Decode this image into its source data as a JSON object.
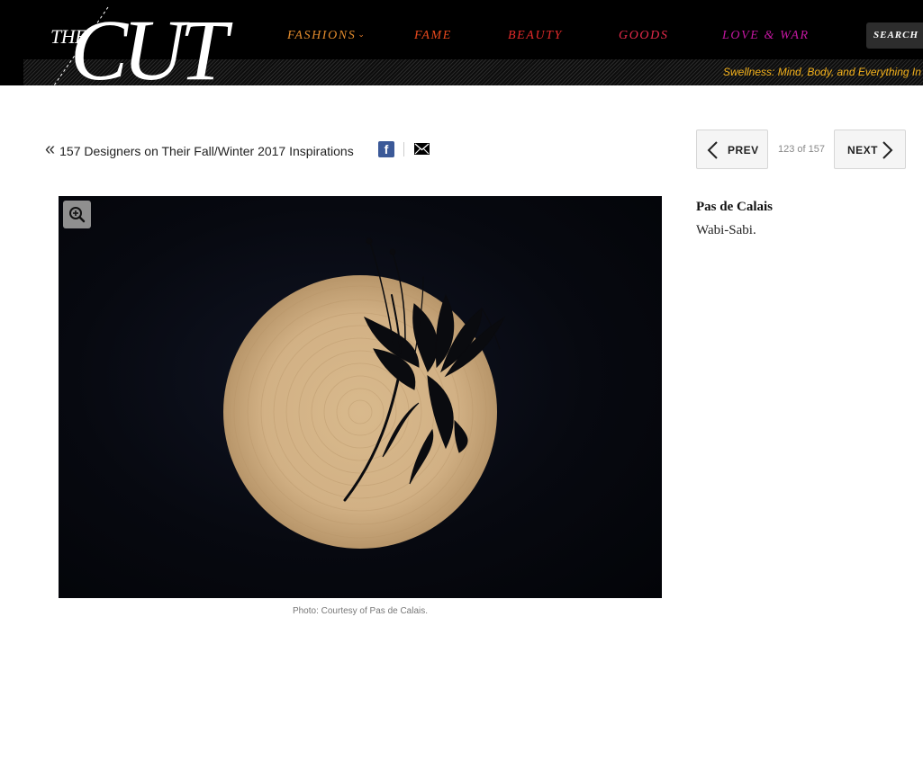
{
  "header": {
    "logo": {
      "the": "THE",
      "cut": "CUT"
    },
    "nav": [
      {
        "label": "FASHIONS",
        "color": "#e08a2c",
        "has_dropdown": true
      },
      {
        "label": "FAME",
        "color": "#e8491d"
      },
      {
        "label": "BEAUTY",
        "color": "#e32a2a"
      },
      {
        "label": "GOODS",
        "color": "#e42a4a"
      },
      {
        "label": "LOVE & WAR",
        "color": "#c2179f"
      }
    ],
    "search_label": "SEARCH",
    "ticker": "Swellness: Mind, Body, and Everything In"
  },
  "slideshow": {
    "back_link": "157 Designers on Their Fall/Winter 2017 Inspirations",
    "prev_label": "PREV",
    "next_label": "NEXT",
    "counter": "123 of 157",
    "caption": "Photo: Courtesy of Pas de Calais.",
    "title": "Pas de Calais",
    "description": "Wabi-Sabi."
  },
  "icons": {
    "back": "double-chevron-left-icon",
    "facebook": "facebook-icon",
    "email": "email-icon",
    "zoom": "zoom-in-icon",
    "prev": "chevron-left-icon",
    "next": "chevron-right-icon"
  },
  "colors": {
    "header_bg": "#000000",
    "ticker": "#f5b21b",
    "facebook": "#3b5998"
  }
}
